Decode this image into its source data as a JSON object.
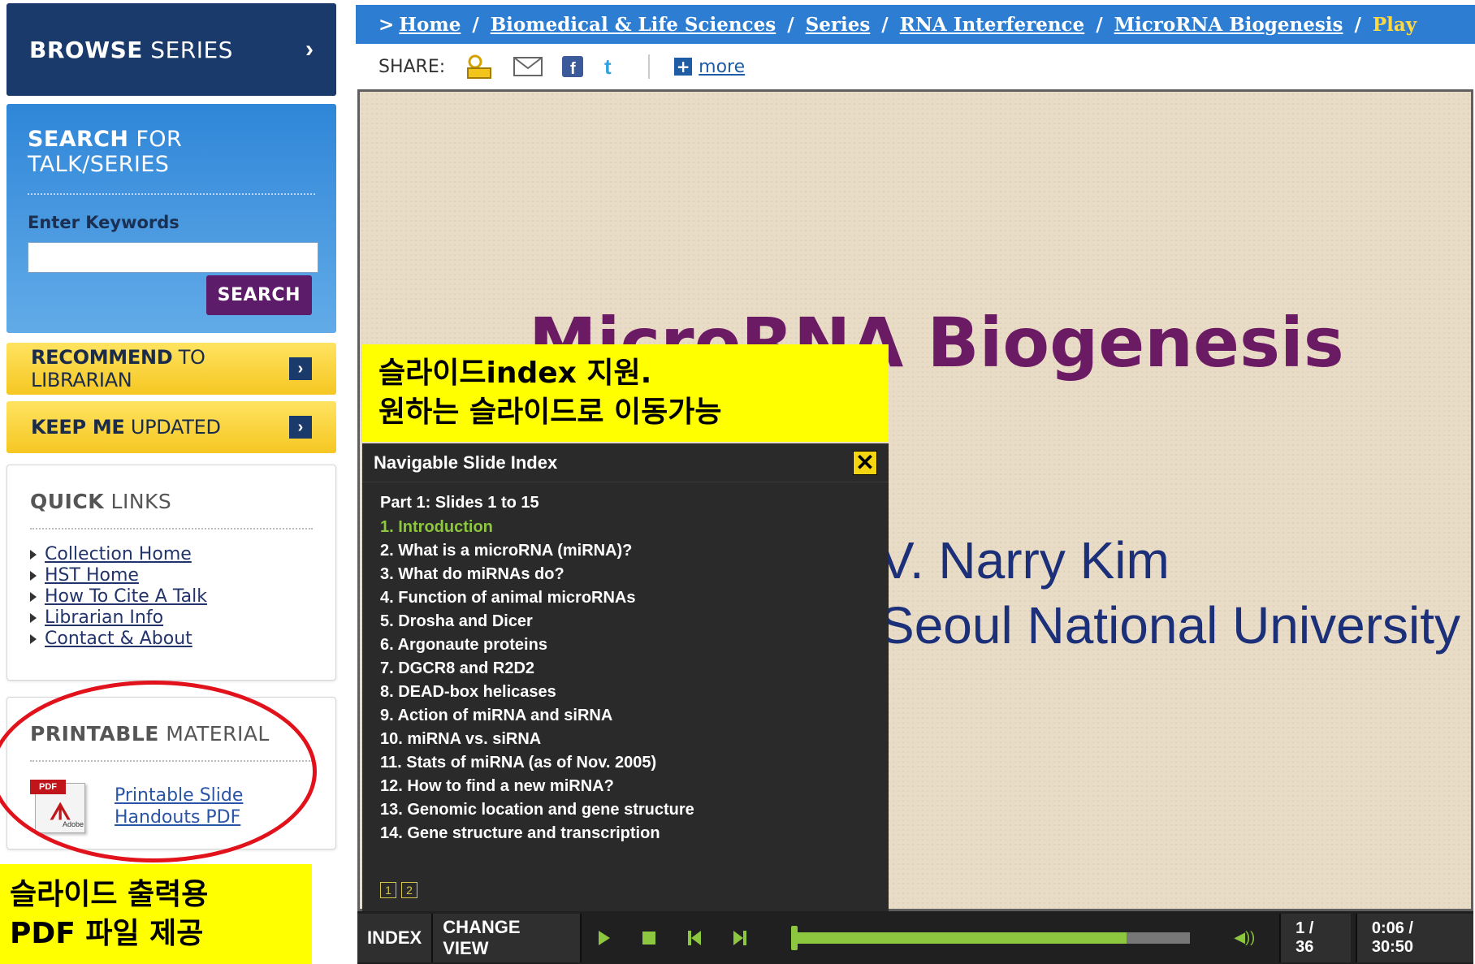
{
  "sidebar": {
    "browse": {
      "bold": "BROWSE",
      "rest": " SERIES",
      "arrow": "›"
    },
    "search": {
      "title_bold": "SEARCH",
      "title_rest": " FOR TALK/SERIES",
      "keywords_label": "Enter Keywords",
      "input_value": "",
      "button": "SEARCH"
    },
    "recommend": {
      "bold": "RECOMMEND",
      "rest": " TO LIBRARIAN",
      "arrow": "›"
    },
    "keep": {
      "bold": "KEEP ME",
      "rest": " UPDATED",
      "arrow": "›"
    },
    "quick_links": {
      "title_bold": "QUICK",
      "title_rest": " LINKS",
      "items": [
        "Collection Home",
        "HST Home",
        "How To Cite A Talk",
        "Librarian Info",
        "Contact & About"
      ]
    },
    "printable": {
      "title_bold": "PRINTABLE",
      "title_rest": " MATERIAL",
      "pdf_tag": "PDF",
      "pdf_sub": "Adobe",
      "link_line1": "Printable Slide",
      "link_line2": "Handouts PDF"
    }
  },
  "annotations": {
    "left_line1": "슬라이드 출력용",
    "left_line2": "PDF 파일 제공",
    "slide_line1": "슬라이드index 지원.",
    "slide_line2": "원하는 슬라이드로 이동가능",
    "highlight_color": "#ffff00",
    "circle_color": "#e1121b"
  },
  "breadcrumb": {
    "prefix": ">",
    "items": [
      "Home",
      "Biomedical & Life Sciences",
      "Series",
      "RNA Interference",
      "MicroRNA Biogenesis"
    ],
    "current": "Play"
  },
  "share": {
    "label": "SHARE:",
    "icons": [
      "share-email-people-icon",
      "mail-icon",
      "facebook-icon",
      "twitter-icon"
    ],
    "more": "more"
  },
  "slide": {
    "title_visible": "MicroRNA  Biogenesis",
    "line2": "V. Narry Kim",
    "line3": "Seoul National University"
  },
  "slide_index": {
    "title": "Navigable Slide Index",
    "part": "Part 1: Slides 1 to 15",
    "items": [
      "1. Introduction",
      "2. What is a microRNA (miRNA)?",
      "3. What do miRNAs do?",
      "4. Function of animal microRNAs",
      "5. Drosha and Dicer",
      "6. Argonaute proteins",
      "7. DGCR8 and R2D2",
      "8. DEAD-box helicases",
      "9. Action of miRNA and siRNA",
      "10. miRNA vs. siRNA",
      "11. Stats of miRNA (as of Nov. 2005)",
      "12. How to find a new miRNA?",
      "13. Genomic location and gene structure",
      "14. Gene structure and transcription"
    ],
    "active_index": 0,
    "pages": [
      "1",
      "2"
    ]
  },
  "player": {
    "index_label": "INDEX",
    "change_view_label": "CHANGE VIEW",
    "progress_buffered": 0.84,
    "slide_counter": "1 / 36",
    "time": "0:06 / 30:50",
    "accent": "#8dc63f"
  }
}
